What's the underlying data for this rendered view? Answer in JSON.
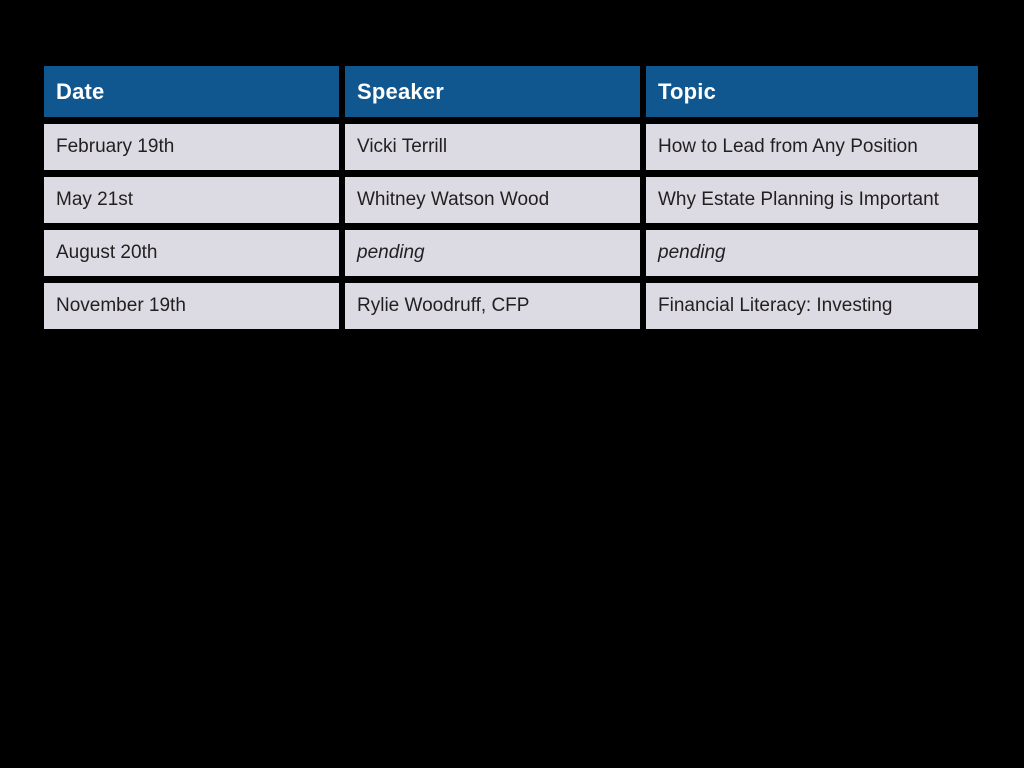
{
  "slide": {
    "background_color": "#000000"
  },
  "table": {
    "header_background": "#10568F",
    "header_text_color": "#FFFFFF",
    "cell_background": "#DCDBE3",
    "cell_text_color": "#231F20",
    "columns": [
      {
        "key": "date",
        "label": "Date"
      },
      {
        "key": "speaker",
        "label": "Speaker"
      },
      {
        "key": "topic",
        "label": "Topic"
      }
    ],
    "rows": [
      {
        "date": "February 19th",
        "speaker": "Vicki Terrill",
        "topic": "How to Lead from Any Position",
        "speaker_pending": false,
        "topic_pending": false
      },
      {
        "date": "May 21st",
        "speaker": "Whitney Watson Wood",
        "topic": "Why Estate Planning is Important",
        "speaker_pending": false,
        "topic_pending": false
      },
      {
        "date": "August 20th",
        "speaker": "pending",
        "topic": "pending",
        "speaker_pending": true,
        "topic_pending": true
      },
      {
        "date": "November 19th",
        "speaker": "Rylie Woodruff, CFP",
        "topic": "Financial Literacy: Investing",
        "speaker_pending": false,
        "topic_pending": false
      }
    ]
  }
}
